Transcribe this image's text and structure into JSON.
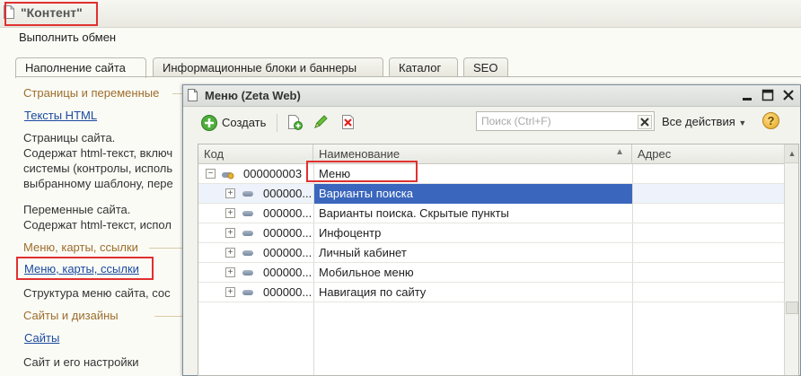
{
  "window": {
    "title": "\"Контент\""
  },
  "main": {
    "exchange_link": "Выполнить обмен",
    "tabs": [
      {
        "label": "Наполнение сайта"
      },
      {
        "label": "Информационные блоки и баннеры"
      },
      {
        "label": "Каталог"
      },
      {
        "label": "SEO"
      }
    ],
    "sections": {
      "pages": {
        "title": "Страницы и переменные",
        "link": "Тексты HTML",
        "desc1": [
          "Страницы сайта.",
          "Содержат html-текст, включ",
          "системы (контролы, исполь",
          "выбранному шаблону, пере"
        ],
        "desc2": [
          "Переменные сайта.",
          "Содержат html-текст, испол"
        ]
      },
      "menus": {
        "title": "Меню, карты, ссылки",
        "link": "Меню, карты, ссылки",
        "desc": "Структура меню сайта, сос"
      },
      "sites": {
        "title": "Сайты и дизайны",
        "link": "Сайты",
        "desc": "Сайт и его настройки"
      }
    }
  },
  "modal": {
    "title": "Меню (Zeta Web)",
    "toolbar": {
      "create_label": "Создать",
      "search_placeholder": "Поиск (Ctrl+F)",
      "all_actions_label": "Все действия",
      "help_label": "?"
    },
    "grid": {
      "columns": [
        "Код",
        "Наименование",
        "Адрес"
      ],
      "rows": [
        {
          "code": "000000003",
          "name": "Меню",
          "address": ""
        },
        {
          "code": "000000...",
          "name": "Варианты поиска",
          "address": ""
        },
        {
          "code": "000000...",
          "name": "Варианты поиска. Скрытые пункты",
          "address": ""
        },
        {
          "code": "000000...",
          "name": "Инфоцентр",
          "address": ""
        },
        {
          "code": "000000...",
          "name": "Личный кабинет",
          "address": ""
        },
        {
          "code": "000000...",
          "name": "Мобильное меню",
          "address": ""
        },
        {
          "code": "000000...",
          "name": "Навигация по сайту",
          "address": ""
        }
      ]
    }
  },
  "colors": {
    "highlight_box": "#e03030",
    "selected_row": "#3a66bd",
    "group_header": "#9c6e2c",
    "link": "#1a4aa0"
  },
  "icons": {
    "title": "document-icon",
    "create": "plus-circle-icon",
    "copy": "copy-icon",
    "edit": "pencil-icon",
    "delete": "delete-icon",
    "clear": "close-icon",
    "help": "help-icon"
  }
}
